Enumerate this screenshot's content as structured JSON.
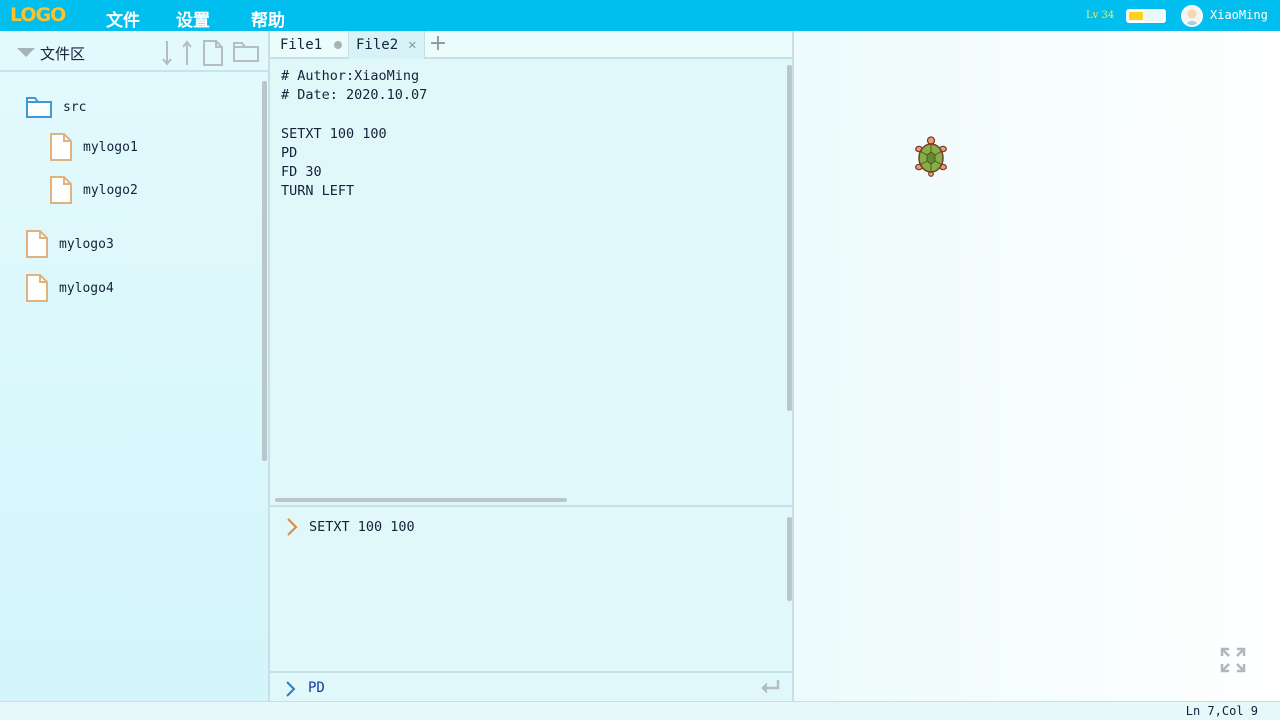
{
  "app": {
    "logo": "LOGO",
    "menu": [
      "文件",
      "设置",
      "帮助"
    ],
    "level": "Lv 34",
    "battery_fraction": 0.4,
    "username": "XiaoMing"
  },
  "sidebar": {
    "title": "文件区",
    "tools": [
      "sort-down-icon",
      "sort-up-icon",
      "new-file-icon",
      "new-folder-icon"
    ],
    "tree": [
      {
        "type": "folder",
        "label": "src",
        "icon": "folder-icon"
      },
      {
        "type": "file",
        "label": "mylogo1",
        "icon": "file-icon",
        "parent": "src"
      },
      {
        "type": "file",
        "label": "mylogo2",
        "icon": "file-icon",
        "parent": "src"
      },
      {
        "type": "file",
        "label": "mylogo3",
        "icon": "file-icon"
      },
      {
        "type": "file",
        "label": "mylogo4",
        "icon": "file-icon"
      }
    ]
  },
  "editor": {
    "tabs": [
      {
        "label": "File1",
        "state": "unsaved"
      },
      {
        "label": "File2",
        "state": "active"
      }
    ],
    "code": "# Author:XiaoMing\n# Date: 2020.10.07\n\nSETXT 100 100\nPD\nFD 30\nTURN LEFT",
    "console_line": "SETXT 100 100",
    "input_value": "PD"
  },
  "status": {
    "cursor": "Ln 7,Col 9"
  },
  "colors": {
    "accent": "#00bfef",
    "logo": "#ffc02a",
    "folder": "#3a9bd8",
    "file": "#e0b27e",
    "console_chevron": "#d98a3e",
    "input_chevron": "#2b7fb8"
  }
}
